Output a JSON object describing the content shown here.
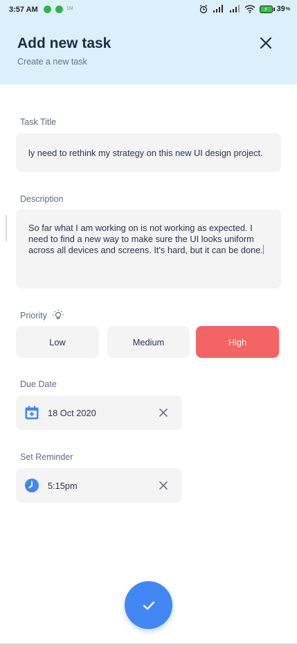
{
  "status_bar": {
    "time": "3:57 AM",
    "small_text": "1M",
    "battery_level": "39",
    "battery_unit": "%"
  },
  "header": {
    "title": "Add new task",
    "subtitle": "Create a new task"
  },
  "task_title": {
    "label": "Task Title",
    "value": "ly need to rethink my strategy on this new UI design project."
  },
  "description": {
    "label": "Description",
    "value": "So far what I am working on is not working as expected. I need to find a new way to make sure the UI looks uniform across all devices and screens. It's hard, but it can be done."
  },
  "priority": {
    "label": "Priority",
    "options": [
      "Low",
      "Medium",
      "High"
    ],
    "selected": "High"
  },
  "due_date": {
    "label": "Due Date",
    "value": "18 Oct 2020"
  },
  "reminder": {
    "label": "Set Reminder",
    "value": "5:15pm"
  },
  "colors": {
    "header_bg": "#dcf0fb",
    "accent_blue": "#4286f4",
    "priority_high": "#f46464",
    "field_bg": "#f4f4f4"
  }
}
